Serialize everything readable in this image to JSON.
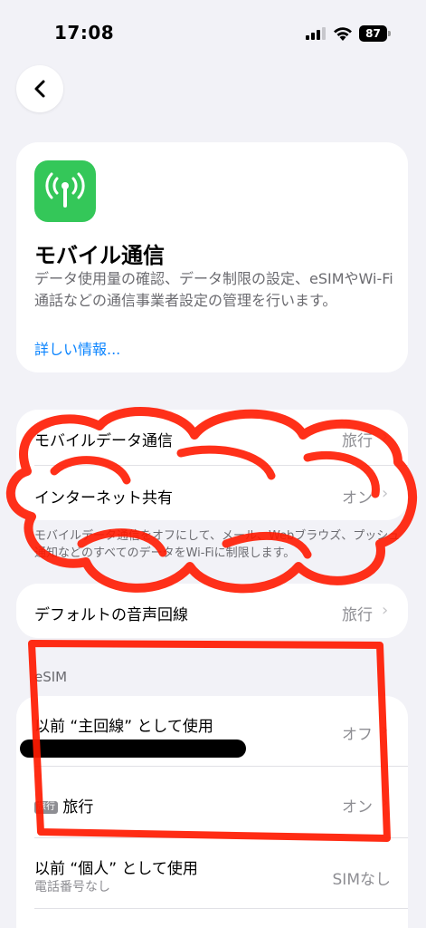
{
  "status_bar": {
    "time": "17:08",
    "battery": "87"
  },
  "header": {
    "title": "モバイル通信",
    "description": "データ使用量の確認、データ制限の設定、eSIMやWi-Fi通話などの通信事業者設定の管理を行います。",
    "more_link": "詳しい情報..."
  },
  "group1": {
    "rows": [
      {
        "label": "モバイルデータ通信",
        "value": "旅行"
      },
      {
        "label": "インターネット共有",
        "value": "オン"
      }
    ],
    "footnote": "モバイルデータ通信をオフにして、メール、Webブラウズ、プッシュ通知などのすべてのデータをWi-Fiに制限します。"
  },
  "group2": {
    "label": "デフォルトの音声回線",
    "value": "旅行"
  },
  "esim": {
    "header": "eSIM",
    "rows": [
      {
        "label": "以前 “主回線” として使用",
        "value": "オフ"
      },
      {
        "badge": "旅行",
        "label": "旅行",
        "value": "オン"
      },
      {
        "label": "以前 “個人” として使用",
        "sublabel": "電話番号なし",
        "value": "SIMなし"
      }
    ]
  },
  "annotation_color": "#ff1a00"
}
